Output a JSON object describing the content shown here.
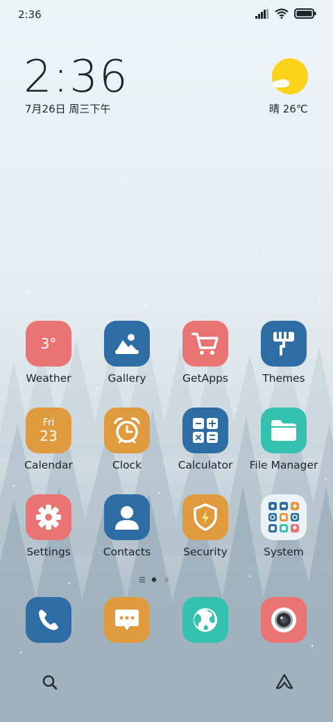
{
  "status": {
    "time": "2:36"
  },
  "clock_widget": {
    "time": "2:36",
    "date": "7月26日 周三下午"
  },
  "weather_widget": {
    "text": "晴 26℃"
  },
  "apps": [
    {
      "label": "Weather",
      "icon": "weather-icon",
      "badge": "3°"
    },
    {
      "label": "Gallery",
      "icon": "gallery-icon"
    },
    {
      "label": "GetApps",
      "icon": "cart-icon"
    },
    {
      "label": "Themes",
      "icon": "paint-roller-icon"
    },
    {
      "label": "Calendar",
      "icon": "calendar-icon",
      "day": "Fri",
      "date": "23"
    },
    {
      "label": "Clock",
      "icon": "alarm-clock-icon"
    },
    {
      "label": "Calculator",
      "icon": "calculator-icon"
    },
    {
      "label": "File Manager",
      "icon": "folder-icon"
    },
    {
      "label": "Settings",
      "icon": "gear-icon"
    },
    {
      "label": "Contacts",
      "icon": "person-icon"
    },
    {
      "label": "Security",
      "icon": "shield-bolt-icon"
    },
    {
      "label": "System",
      "icon": "app-folder-icon"
    }
  ],
  "dock": [
    "phone-icon",
    "message-icon",
    "browser-icon",
    "camera-icon"
  ],
  "colors": {
    "red": "#ea7373",
    "blue": "#2d6da4",
    "orange": "#df9a3d",
    "teal": "#35c1b0",
    "sun": "#f9d21a"
  }
}
